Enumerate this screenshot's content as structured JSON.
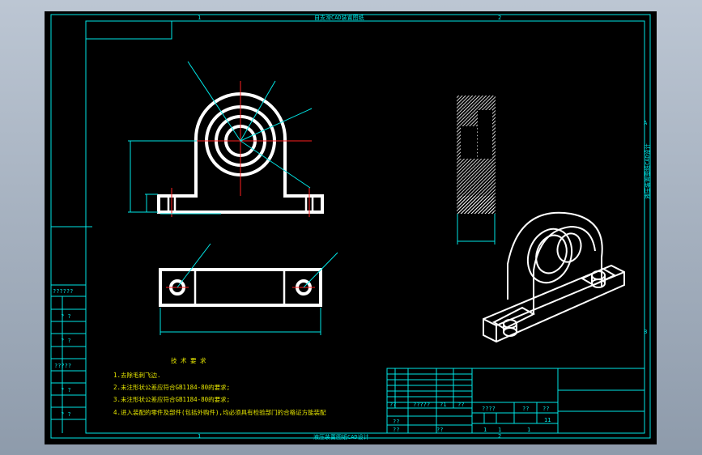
{
  "drawing": {
    "top_caption": "自支滑CAD装置图纸",
    "bottom_caption": "液压装置图纸CAD设计",
    "right_caption": "液压装置图纸CAD设计",
    "zone_marks": {
      "top": [
        "1",
        "2"
      ],
      "bottom": [
        "1",
        "2"
      ],
      "right": [
        "A",
        "B"
      ]
    }
  },
  "left_strip": {
    "cells": [
      "??????",
      "? ?",
      "? ?",
      "?????",
      "? ?",
      "? ?"
    ]
  },
  "technical_requirements": {
    "title": "技 术 要 求",
    "items": [
      "1.去除毛刺飞边.",
      "2.未注形状公差应符合GB1184-80的要求;",
      "3.未注形状公差应符合GB1184-80的要求;",
      "4.进入装配的零件及部件(包括外购件),均必须具有检验部门的合格证方能装配"
    ]
  },
  "title_block": {
    "row_a": [
      "??",
      "?????",
      "?1",
      "??"
    ],
    "row_b": [
      "????",
      "??",
      "??"
    ],
    "row_c": [
      "??",
      "??"
    ],
    "scale_row": [
      "1",
      "1",
      "1",
      "11"
    ],
    "left_bottom": [
      "??",
      "??",
      "??"
    ]
  }
}
